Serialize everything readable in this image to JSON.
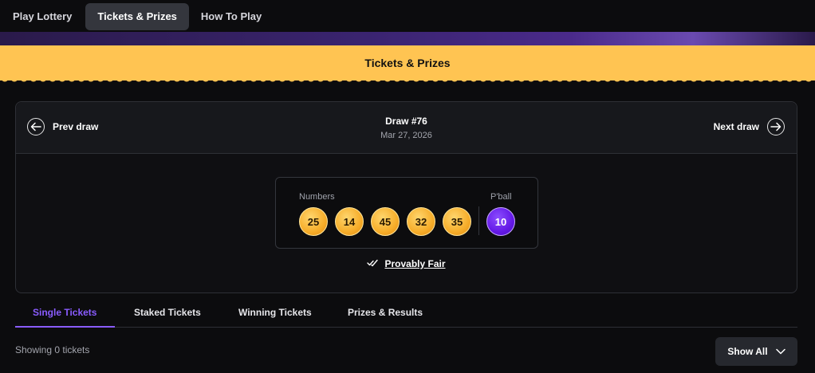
{
  "topnav": {
    "tabs": [
      "Play Lottery",
      "Tickets & Prizes",
      "How To Play"
    ],
    "active_index": 1
  },
  "banner": {
    "title": "Tickets & Prizes"
  },
  "draw": {
    "prev_label": "Prev draw",
    "next_label": "Next draw",
    "title": "Draw #76",
    "date": "Mar 27, 2026",
    "numbers_label": "Numbers",
    "pball_label": "P'ball",
    "numbers": [
      "25",
      "14",
      "45",
      "32",
      "35"
    ],
    "powerball": "10",
    "fair_label": "Provably Fair"
  },
  "ticket_tabs": {
    "labels": [
      "Single Tickets",
      "Staked Tickets",
      "Winning Tickets",
      "Prizes & Results"
    ],
    "active_index": 0
  },
  "footer": {
    "showing_text": "Showing 0 tickets",
    "show_all_label": "Show All"
  },
  "colors": {
    "accent": "#8a5cff",
    "banner": "#ffc452",
    "ball": "#f6ad2a",
    "powerball": "#6419e6"
  }
}
